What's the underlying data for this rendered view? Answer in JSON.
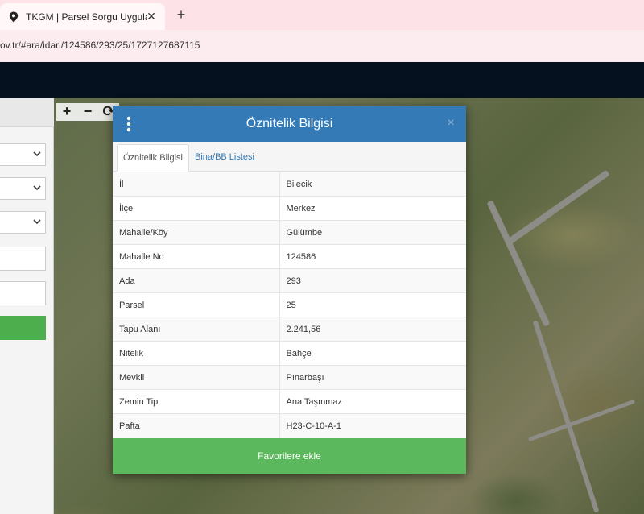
{
  "browser": {
    "tab_title": "TKGM | Parsel Sorgu Uygulamas",
    "tab_close": "✕",
    "new_tab": "+",
    "url": "ov.tr/#ara/idari/124586/293/25/1727127687115"
  },
  "map": {
    "controls": [
      "+",
      "−",
      "⟳"
    ]
  },
  "modal": {
    "title": "Öznitelik Bilgisi",
    "close": "×",
    "tabs": [
      {
        "label": "Öznitelik Bilgisi",
        "active": true
      },
      {
        "label": "Bina/BB Listesi",
        "active": false
      }
    ],
    "rows": [
      {
        "key": "İl",
        "value": "Bilecik"
      },
      {
        "key": "İlçe",
        "value": "Merkez"
      },
      {
        "key": "Mahalle/Köy",
        "value": "Gülümbe"
      },
      {
        "key": "Mahalle No",
        "value": "124586"
      },
      {
        "key": "Ada",
        "value": "293"
      },
      {
        "key": "Parsel",
        "value": "25"
      },
      {
        "key": "Tapu Alanı",
        "value": "2.241,56"
      },
      {
        "key": "Nitelik",
        "value": "Bahçe"
      },
      {
        "key": "Mevkii",
        "value": "Pınarbaşı"
      },
      {
        "key": "Zemin Tip",
        "value": "Ana Taşınmaz"
      },
      {
        "key": "Pafta",
        "value": "H23-C-10-A-1"
      }
    ],
    "favorite_button": "Favorilere ekle"
  },
  "colors": {
    "header_blue": "#337ab7",
    "success_green": "#5cb85c",
    "appbar_dark": "#061120",
    "tab_pink": "#fde2e7"
  }
}
